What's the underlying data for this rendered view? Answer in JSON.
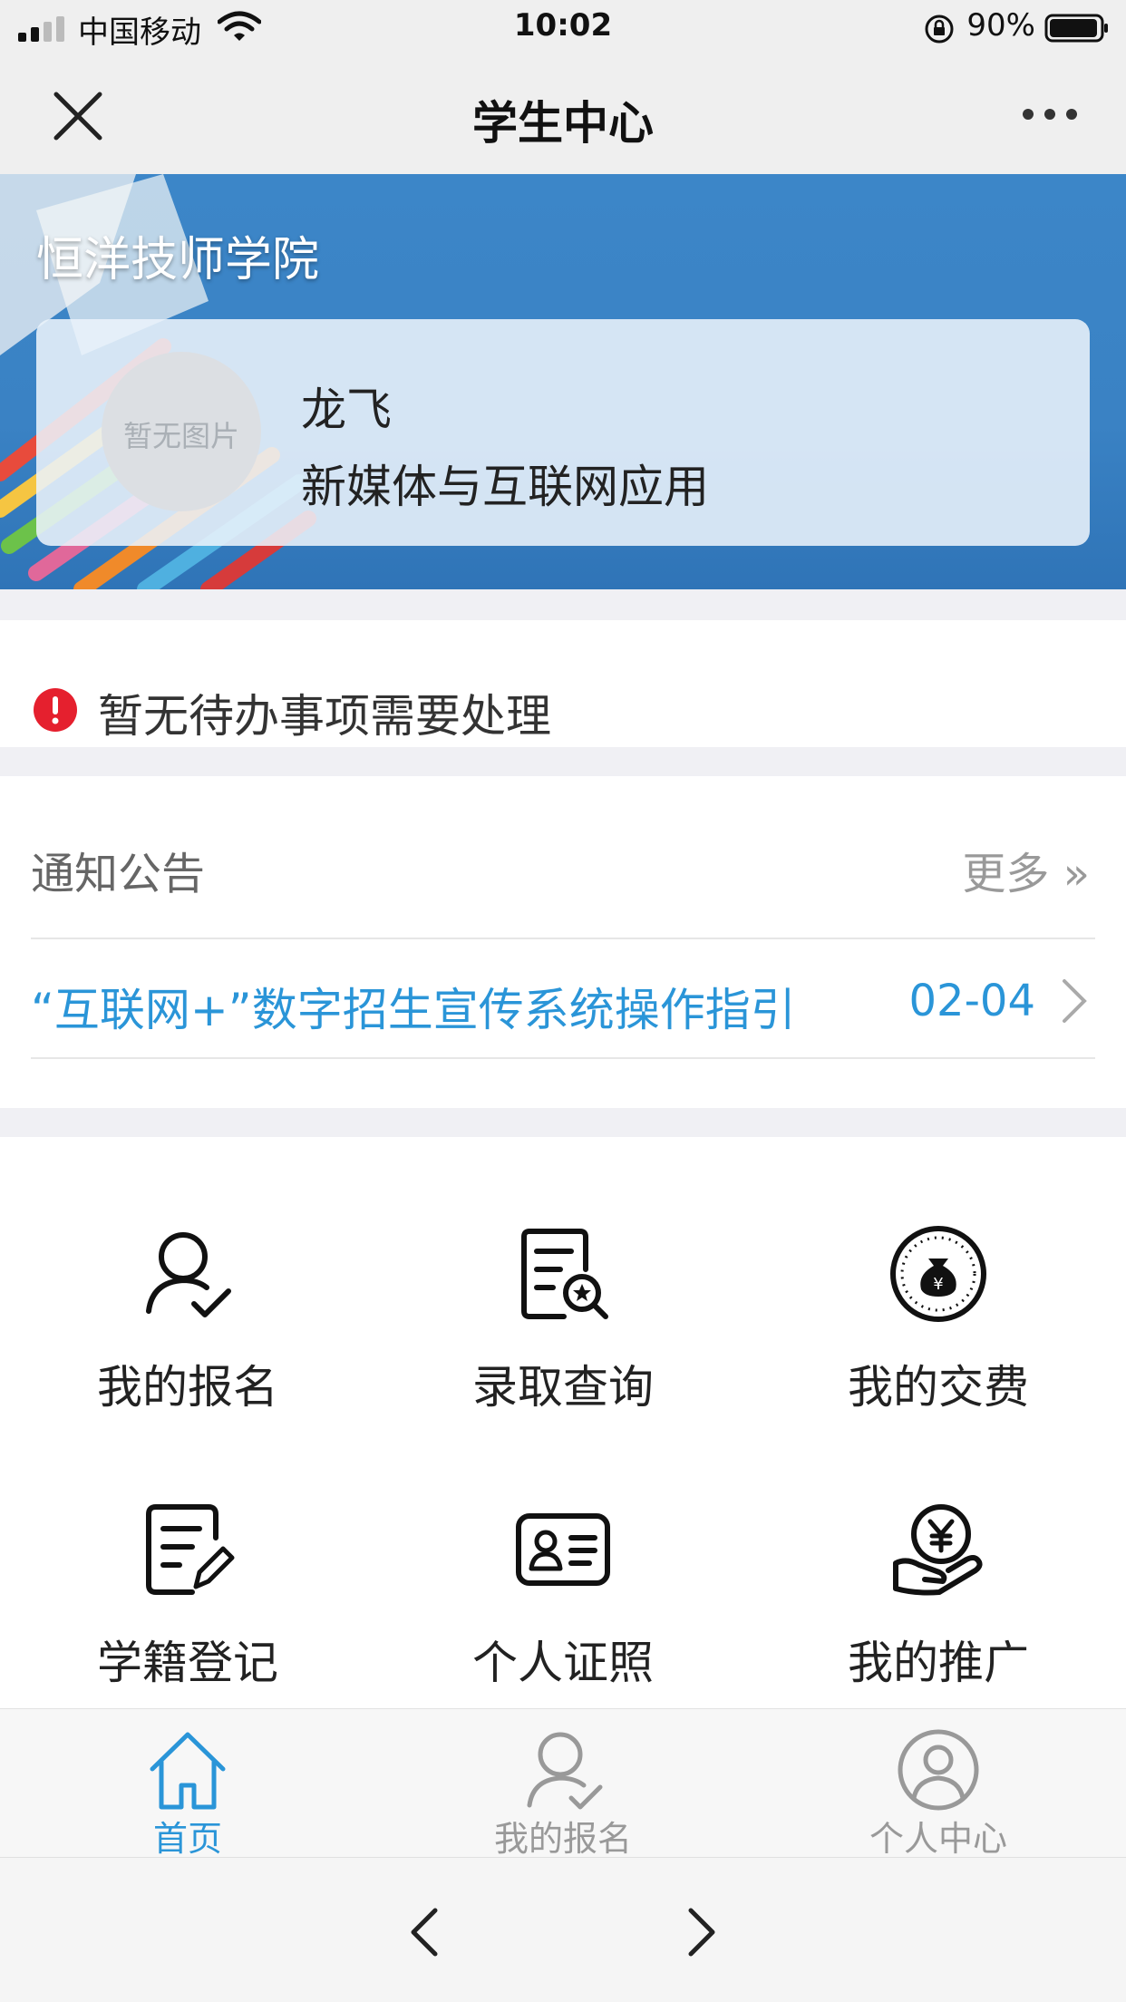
{
  "status_bar": {
    "carrier": "中国移动",
    "time": "10:02",
    "battery": "90%"
  },
  "nav": {
    "title": "学生中心"
  },
  "banner": {
    "school": "恒洋技师学院",
    "avatar_placeholder": "暂无图片",
    "student_name": "龙飞",
    "major": "新媒体与互联网应用"
  },
  "todo": {
    "text": "暂无待办事项需要处理",
    "icon_color": "#e5202e"
  },
  "notices": {
    "title": "通知公告",
    "more": "更多 »",
    "items": [
      {
        "title": "“互联网+”数字招生宣传系统操作指引",
        "date": "02-04"
      }
    ]
  },
  "grid": {
    "items": [
      {
        "label": "我的报名",
        "icon": "user-check-icon"
      },
      {
        "label": "录取查询",
        "icon": "document-search-icon"
      },
      {
        "label": "我的交费",
        "icon": "money-bag-icon"
      },
      {
        "label": "学籍登记",
        "icon": "edit-form-icon"
      },
      {
        "label": "个人证照",
        "icon": "id-card-icon"
      },
      {
        "label": "我的推广",
        "icon": "yuan-hand-icon"
      }
    ]
  },
  "tabbar": {
    "items": [
      {
        "label": "首页",
        "icon": "home-icon",
        "active": true
      },
      {
        "label": "我的报名",
        "icon": "user-check-icon",
        "active": false
      },
      {
        "label": "个人中心",
        "icon": "user-circle-icon",
        "active": false
      }
    ],
    "active_color": "#2a95d8",
    "inactive_color": "#999999"
  }
}
